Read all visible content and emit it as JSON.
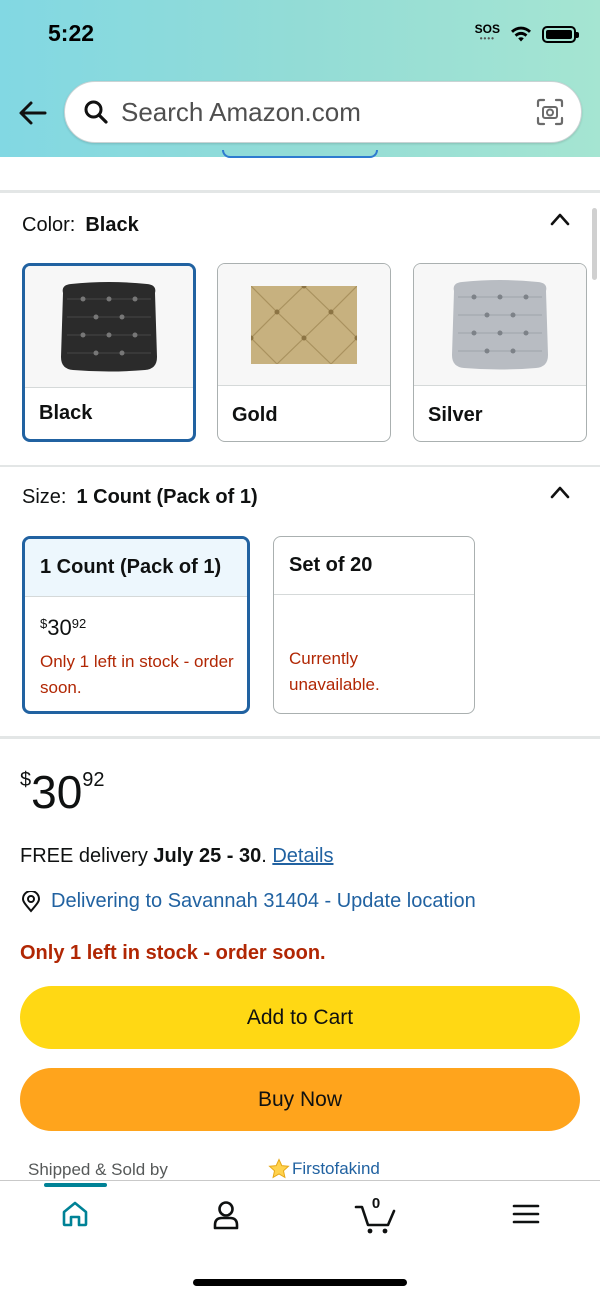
{
  "status_bar": {
    "time": "5:22",
    "sos": "SOS"
  },
  "search": {
    "placeholder": "Search Amazon.com"
  },
  "color_section": {
    "label": "Color:",
    "selected": "Black",
    "options": [
      {
        "name": "Black",
        "selected": true
      },
      {
        "name": "Gold",
        "selected": false
      },
      {
        "name": "Silver",
        "selected": false
      }
    ]
  },
  "size_section": {
    "label": "Size:",
    "selected": "1 Count (Pack of 1)",
    "options": [
      {
        "name": "1 Count (Pack of 1)",
        "currency": "$",
        "price_whole": "30",
        "price_fraction": "92",
        "note": "Only 1 left in stock - order soon.",
        "selected": true
      },
      {
        "name": "Set of 20",
        "note": "Currently unavailable.",
        "selected": false
      }
    ]
  },
  "buy_box": {
    "currency": "$",
    "price_whole": "30",
    "price_fraction": "92",
    "delivery_prefix": "FREE delivery",
    "delivery_dates": "July 25 - 30",
    "delivery_period": ".",
    "details_link": "Details",
    "location_text": "Delivering to Savannah 31404 - Update location",
    "stock_warning": "Only 1 left in stock - order soon.",
    "add_to_cart": "Add to Cart",
    "buy_now": "Buy Now",
    "shipped_sold_by": "Shipped & Sold by",
    "seller_name": "Firstofakind"
  },
  "bottom_nav": {
    "cart_count": "0",
    "items": [
      "home-icon",
      "account-icon",
      "cart-icon",
      "menu-icon"
    ]
  },
  "colors": {
    "accent_blue": "#2162a1",
    "alert_red": "#b12704",
    "add_to_cart": "#ffd814",
    "buy_now": "#ffa41c",
    "nav_teal": "#008296"
  }
}
